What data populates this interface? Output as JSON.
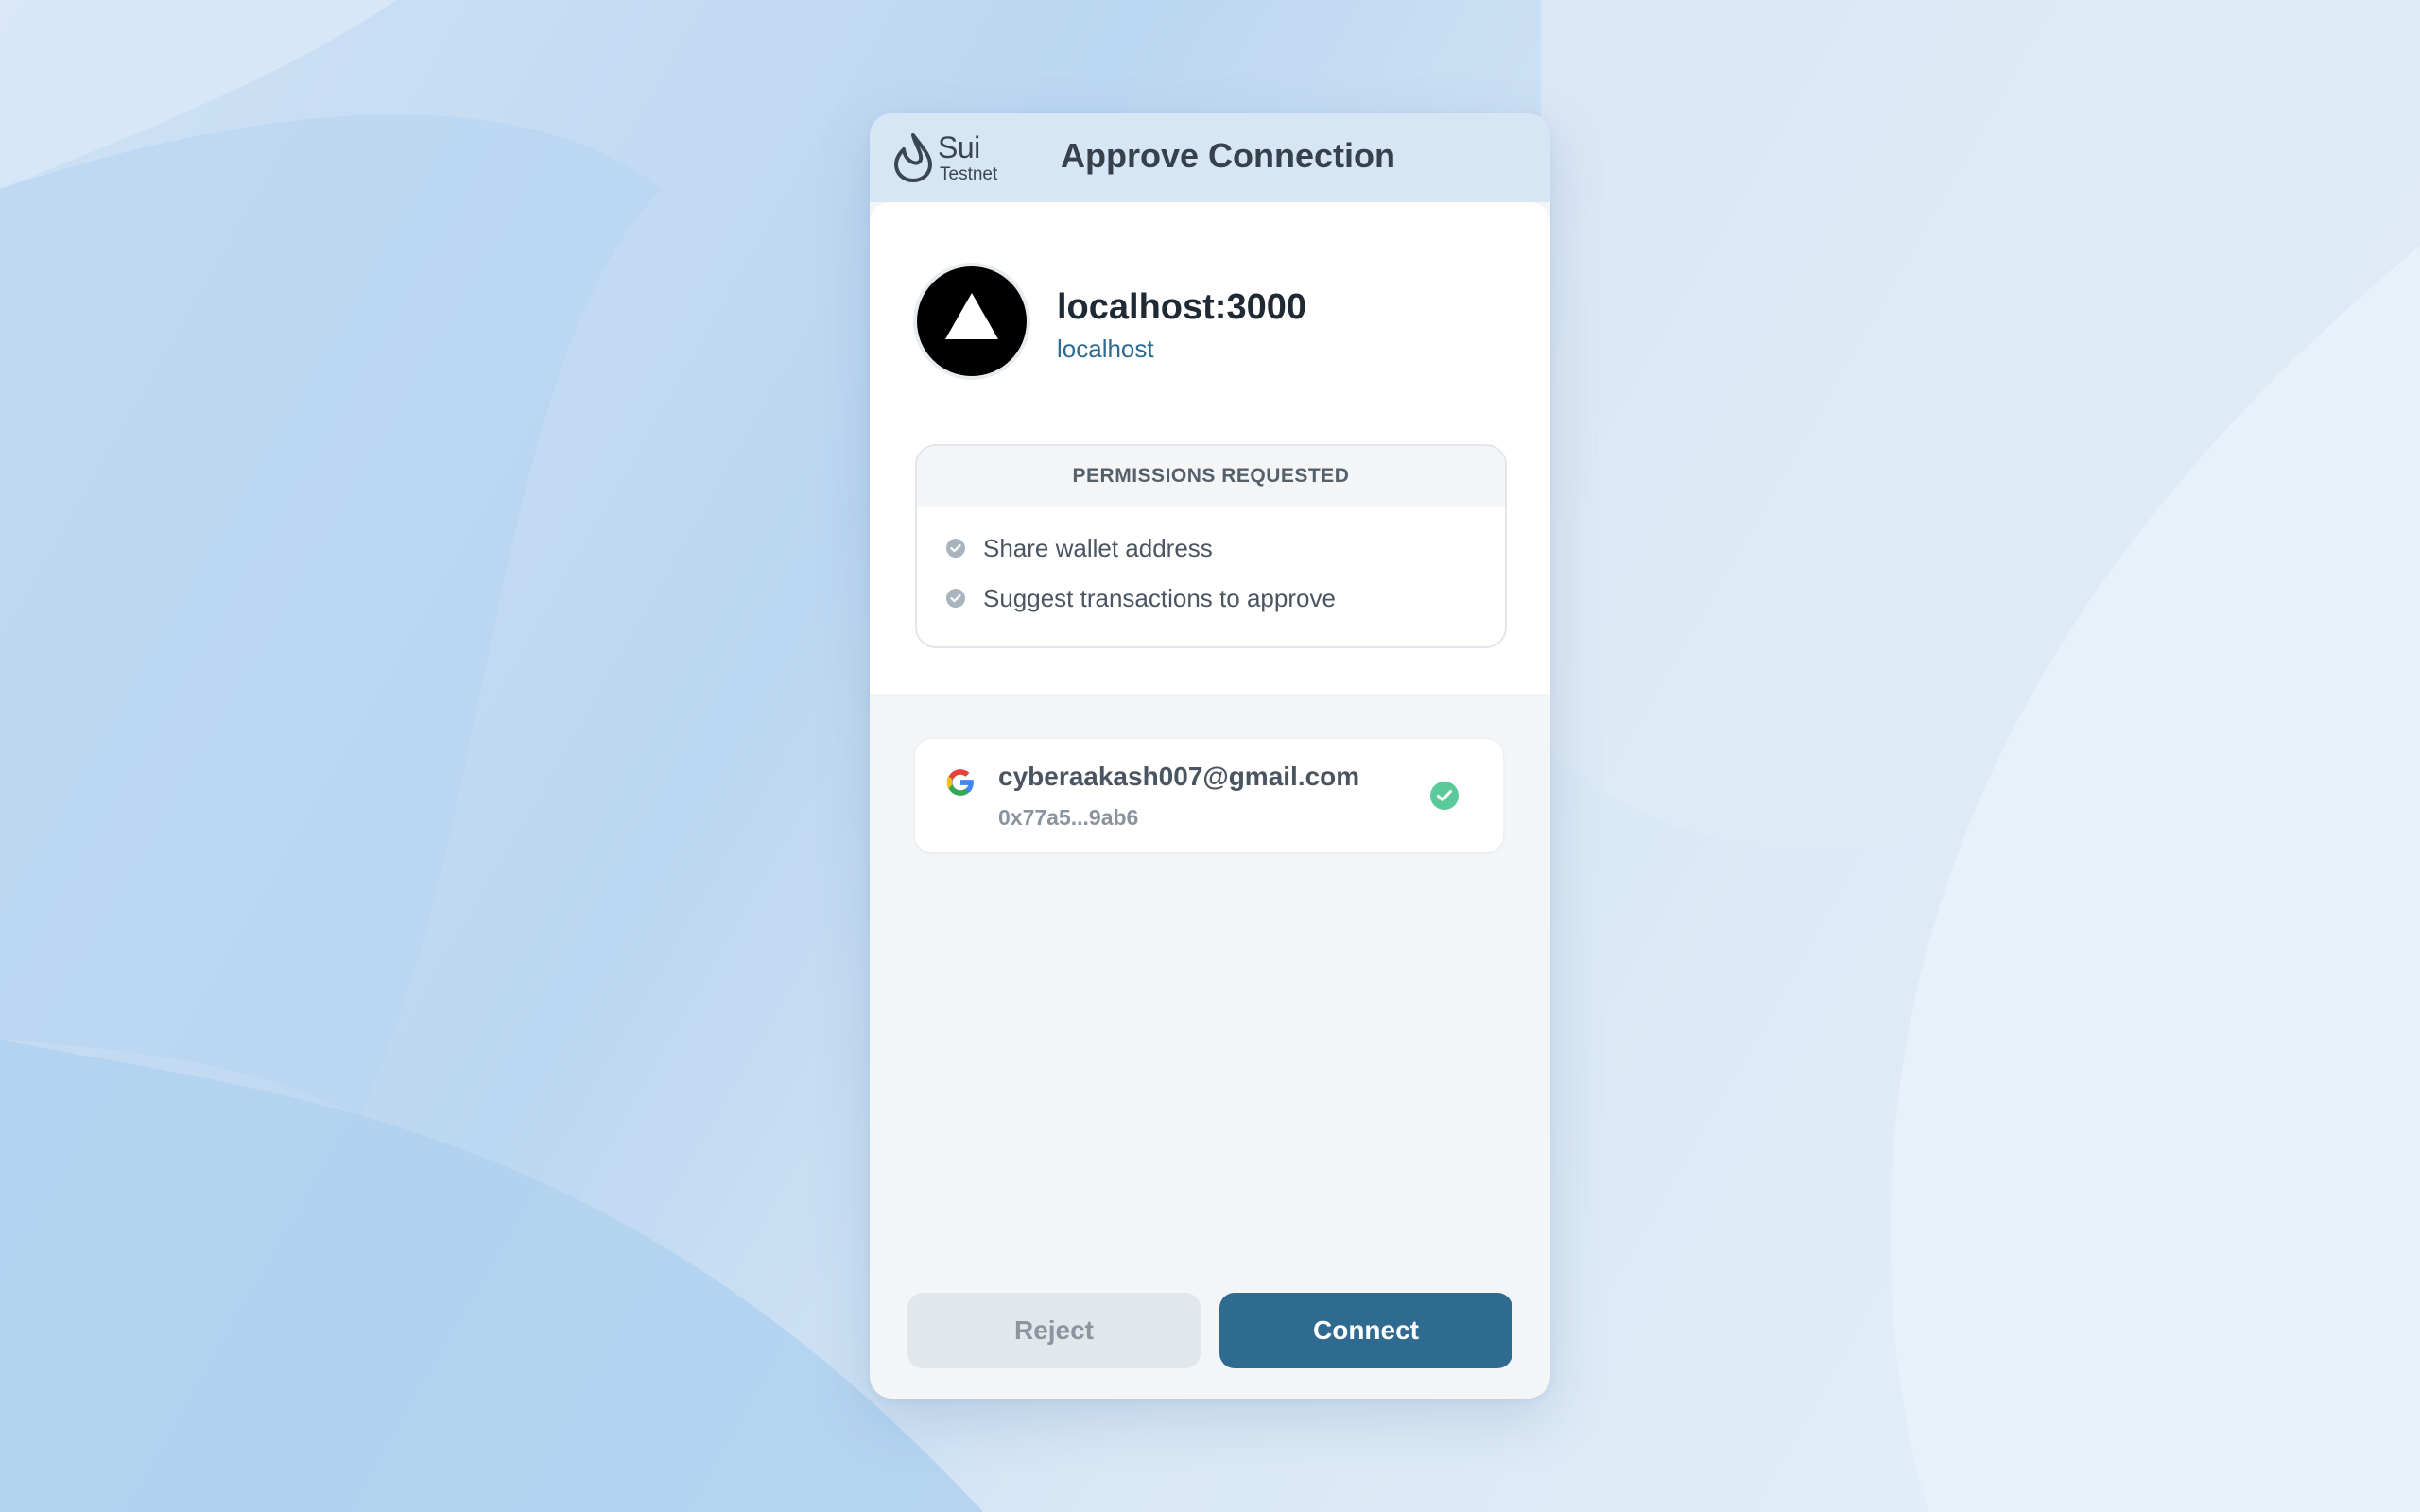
{
  "header": {
    "logo_brand": "Sui",
    "logo_network": "Testnet",
    "title": "Approve Connection"
  },
  "site": {
    "name": "localhost:3000",
    "host": "localhost",
    "icon": "triangle-logo-icon"
  },
  "permissions": {
    "heading": "PERMISSIONS REQUESTED",
    "items": [
      {
        "label": "Share wallet address",
        "icon": "check-circle-icon"
      },
      {
        "label": "Suggest transactions to approve",
        "icon": "check-circle-icon"
      }
    ]
  },
  "account": {
    "provider_icon": "google-icon",
    "email": "cyberaakash007@gmail.com",
    "address": "0x77a5...9ab6",
    "selected": true,
    "selected_icon": "check-circle-icon"
  },
  "actions": {
    "reject_label": "Reject",
    "connect_label": "Connect"
  },
  "colors": {
    "primary": "#2f6b91",
    "header_bg": "#d6e6f5",
    "success": "#5cc99a",
    "muted_button": "#e2e7ec"
  }
}
